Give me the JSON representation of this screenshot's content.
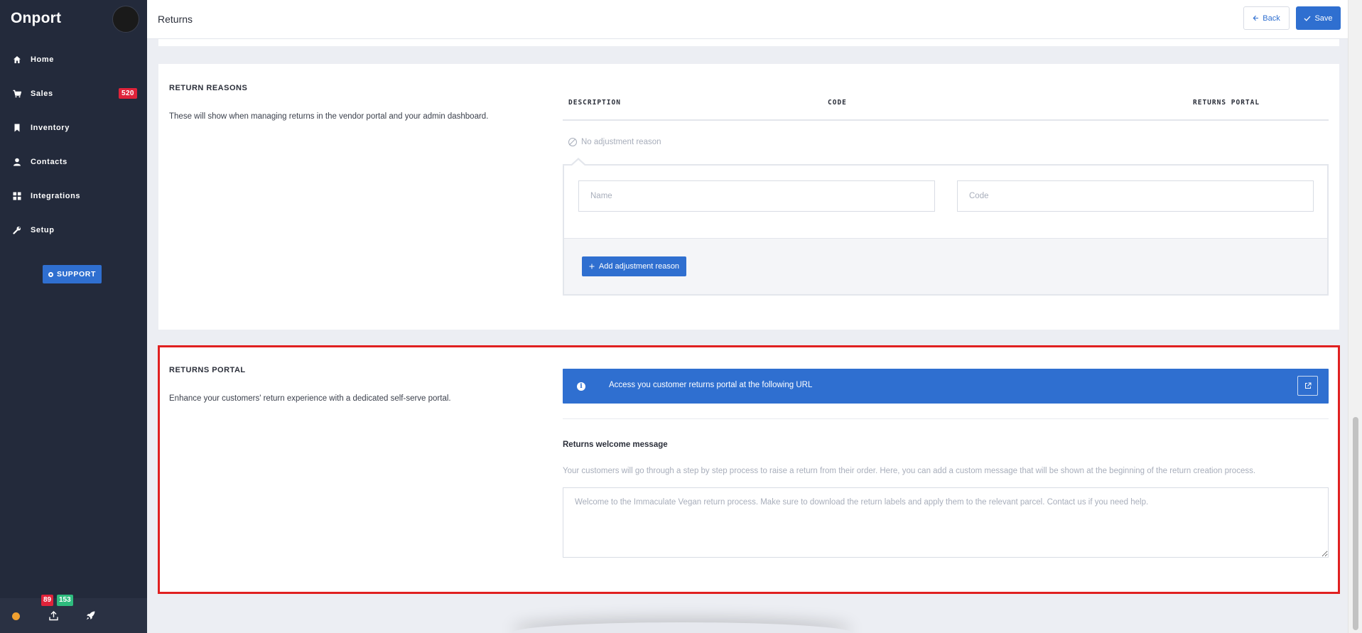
{
  "app": {
    "logo": "Onport"
  },
  "sidebar": {
    "items": [
      {
        "label": "Home",
        "icon": "home-icon"
      },
      {
        "label": "Sales",
        "icon": "cart-icon",
        "badge": "520"
      },
      {
        "label": "Inventory",
        "icon": "bookmark-icon"
      },
      {
        "label": "Contacts",
        "icon": "user-icon"
      },
      {
        "label": "Integrations",
        "icon": "grid-icon"
      },
      {
        "label": "Setup",
        "icon": "wrench-icon"
      }
    ],
    "support_label": "SUPPORT",
    "footer": {
      "badge_red": "89",
      "badge_green": "153"
    }
  },
  "header": {
    "title": "Returns",
    "back_label": "Back",
    "save_label": "Save"
  },
  "reasons": {
    "title": "RETURN REASONS",
    "description": "These will show when managing returns in the vendor portal and your admin dashboard.",
    "columns": [
      "DESCRIPTION",
      "CODE",
      "RETURNS PORTAL"
    ],
    "empty_text": "No adjustment reason",
    "name_placeholder": "Name",
    "code_placeholder": "Code",
    "add_label": "Add adjustment reason"
  },
  "portal": {
    "title": "RETURNS PORTAL",
    "description": "Enhance your customers' return experience with a dedicated self-serve portal.",
    "info_text": "Access you customer returns portal at the following URL",
    "welcome_label": "Returns welcome message",
    "welcome_help": "Your customers will go through a step by step process to raise a return from their order. Here, you can add a custom message that will be shown at the beginning of the return creation process.",
    "welcome_placeholder": "Welcome to the Immaculate Vegan return process. Make sure to download the return labels and apply them to the relevant parcel. Contact us if you need help."
  },
  "colors": {
    "accent": "#2f6fd0",
    "sidebar": "#232a3b",
    "danger": "#e0233a",
    "success": "#2ebc7e",
    "highlight": "#e02020"
  }
}
